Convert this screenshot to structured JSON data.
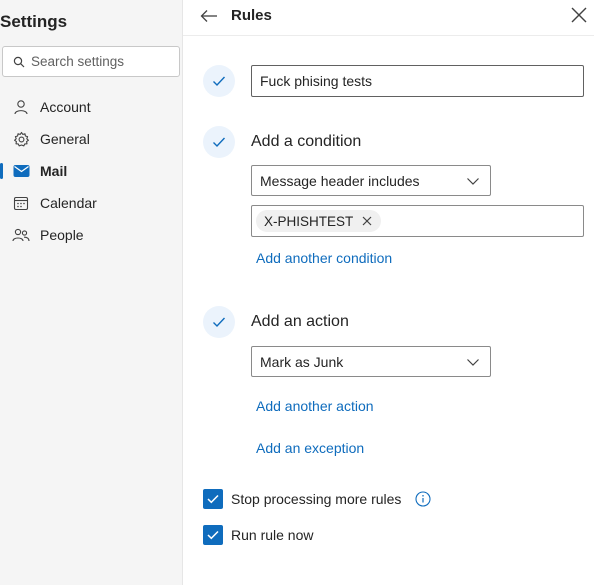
{
  "sidebar": {
    "title": "Settings",
    "search_placeholder": "Search settings",
    "items": [
      {
        "label": "Account",
        "icon": "person-icon",
        "active": false
      },
      {
        "label": "General",
        "icon": "gear-icon",
        "active": false
      },
      {
        "label": "Mail",
        "icon": "mail-icon",
        "active": true
      },
      {
        "label": "Calendar",
        "icon": "calendar-icon",
        "active": false
      },
      {
        "label": "People",
        "icon": "people-icon",
        "active": false
      }
    ]
  },
  "panel": {
    "title": "Rules",
    "rule_name_value": "Fuck phising tests",
    "condition": {
      "heading": "Add a condition",
      "dropdown_value": "Message header includes",
      "tag": "X-PHISHTEST",
      "add_link": "Add another condition"
    },
    "action": {
      "heading": "Add an action",
      "dropdown_value": "Mark as Junk",
      "add_link": "Add another action",
      "exception_link": "Add an exception"
    },
    "options": {
      "stop_processing": {
        "label": "Stop processing more rules",
        "checked": true
      },
      "run_now": {
        "label": "Run rule now",
        "checked": true
      }
    }
  },
  "colors": {
    "accent": "#0f6cbd",
    "step_bg": "#ebf3fc",
    "sidebar_bg": "#f5f5f5"
  }
}
